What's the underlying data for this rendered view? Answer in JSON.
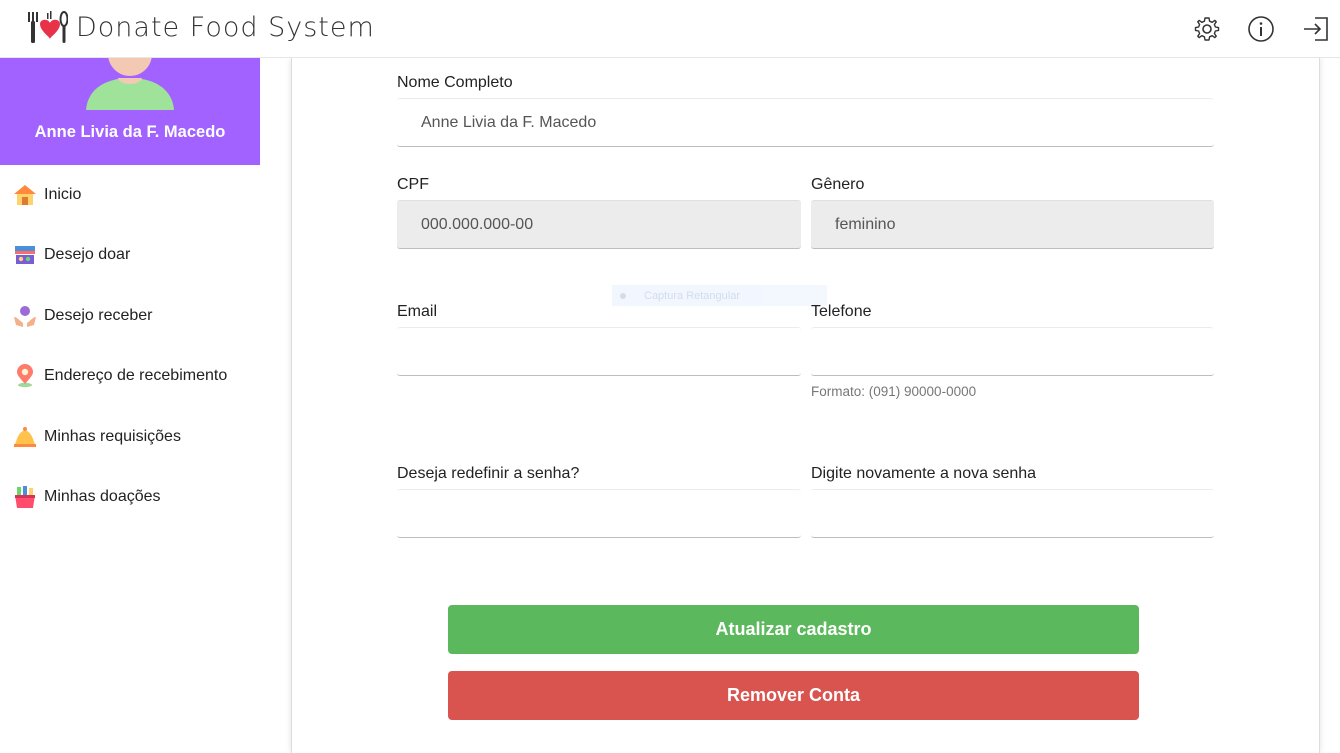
{
  "header": {
    "title": "Donate Food System",
    "icons": [
      "fork-knife-heart-logo",
      "gear-icon",
      "info-icon",
      "logout-icon"
    ]
  },
  "profile": {
    "name": "Anne Livia da F. Macedo",
    "bg_color": "#a262ff"
  },
  "sidebar": {
    "items": [
      {
        "label": "Inicio",
        "icon": "house-icon"
      },
      {
        "label": "Desejo doar",
        "icon": "market-stall-icon"
      },
      {
        "label": "Desejo receber",
        "icon": "hands-receive-icon"
      },
      {
        "label": "Endereço de recebimento",
        "icon": "map-pin-icon"
      },
      {
        "label": "Minhas requisições",
        "icon": "bell-icon"
      },
      {
        "label": "Minhas doações",
        "icon": "gift-basket-icon"
      }
    ]
  },
  "form": {
    "full_name": {
      "label": "Nome Completo",
      "value": "Anne Livia da F. Macedo"
    },
    "cpf": {
      "label": "CPF",
      "value": "000.000.000-00"
    },
    "gender": {
      "label": "Gênero",
      "value": "feminino"
    },
    "email": {
      "label": "Email",
      "value": ""
    },
    "phone": {
      "label": "Telefone",
      "value": "",
      "hint": "Formato: (091) 90000-0000"
    },
    "new_password": {
      "label": "Deseja redefinir a senha?",
      "value": ""
    },
    "confirm_password": {
      "label": "Digite novamente a nova senha",
      "value": ""
    }
  },
  "overlay": {
    "text": "Captura Retangular"
  },
  "buttons": {
    "update": "Atualizar cadastro",
    "remove": "Remover Conta",
    "update_color": "#5cb85c",
    "remove_color": "#d9534f"
  }
}
